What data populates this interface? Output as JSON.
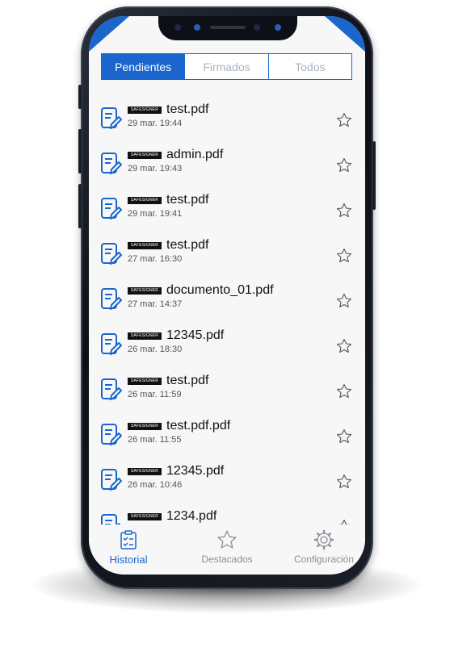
{
  "tabs": [
    {
      "label": "Pendientes",
      "active": true
    },
    {
      "label": "Firmados",
      "active": false
    },
    {
      "label": "Todos",
      "active": false
    }
  ],
  "badge_text": "SAFESIGNER",
  "documents": [
    {
      "name": "test.pdf",
      "date": "29 mar. 19:44"
    },
    {
      "name": "admin.pdf",
      "date": "29 mar. 19:43"
    },
    {
      "name": "test.pdf",
      "date": "29 mar. 19:41"
    },
    {
      "name": "test.pdf",
      "date": "27 mar. 16:30"
    },
    {
      "name": "documento_01.pdf",
      "date": "27 mar. 14:37"
    },
    {
      "name": "12345.pdf",
      "date": "26 mar. 18:30"
    },
    {
      "name": "test.pdf",
      "date": "26 mar. 11:59"
    },
    {
      "name": "test.pdf.pdf",
      "date": "26 mar. 11:55"
    },
    {
      "name": "12345.pdf",
      "date": "26 mar. 10:46"
    },
    {
      "name": "1234.pdf",
      "date": ""
    }
  ],
  "bottom_nav": [
    {
      "label": "Historial",
      "icon": "clipboard-checklist-icon",
      "active": true
    },
    {
      "label": "Destacados",
      "icon": "star-icon",
      "active": false
    },
    {
      "label": "Configuración",
      "icon": "gear-icon",
      "active": false
    }
  ],
  "colors": {
    "accent": "#1a66cc",
    "background": "#f7f7f7",
    "badge": "#111111"
  }
}
